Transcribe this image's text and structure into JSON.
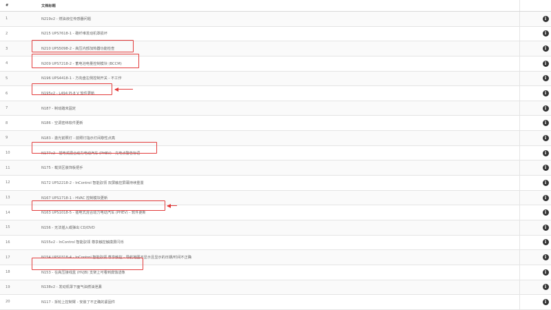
{
  "table": {
    "headers": {
      "num": "#",
      "title": "文档标题",
      "action": ""
    },
    "rows": [
      {
        "num": "1",
        "title": "N219v2 - 燃油液位传感器问题"
      },
      {
        "num": "2",
        "title": "N215 UPS7618-1 - 碳纤维发动机罩损坏"
      },
      {
        "num": "3",
        "title": "N210 UPS5098-2 - 高压内部加热器功能检查"
      },
      {
        "num": "4",
        "title": "N209 UPS7218-2 - 蓄电池电量控制模块 (BCCM)"
      },
      {
        "num": "5",
        "title": "N196 UPS4418-1 - 方向盘左侧控制开关 - 不工作"
      },
      {
        "num": "6",
        "title": "N195v2 - L494 PI-8 V 软件更新"
      },
      {
        "num": "7",
        "title": "N187 - 制动踏未固定"
      },
      {
        "num": "8",
        "title": "N186 - 空调密纬软件更新"
      },
      {
        "num": "9",
        "title": "N183 - 激光前照灯 - 前照灯指示灯间歇性点亮"
      },
      {
        "num": "10",
        "title": "N177v2 - 插电式混合动力电动汽车 (PHEV) - 充电点警告标语"
      },
      {
        "num": "11",
        "title": "N175 - 载货区装饰板把手"
      },
      {
        "num": "12",
        "title": "N172 UPS2218-2 - InControl 智能驭领 双屏触控屏幕持续重置"
      },
      {
        "num": "13",
        "title": "N167 UPS1718-1 - HVAC 控制模块更新"
      },
      {
        "num": "14",
        "title": "N163 UPS1018-5 - 插电式混合动力电动汽车 (PHEV) - 软件更新"
      },
      {
        "num": "15",
        "title": "N156 - 无法插入或弹出 CD/DVD"
      },
      {
        "num": "16",
        "title": "N155v2 - InControl 智能驭领 尊享触控触摸屏闪烁"
      },
      {
        "num": "17",
        "title": "N154 UPS0318-4 - InControl 智能驭领 尊享触控 - 导航地图不显示且显示的日期/时间不正确"
      },
      {
        "num": "18",
        "title": "N153 - 在高压接线盒 (HVJB) 支架上可看到腐蚀迹象"
      },
      {
        "num": "19",
        "title": "N138v2 - 发动机罩下面气油燃油泄漏"
      },
      {
        "num": "20",
        "title": "N117 - 拆轮上控制臂 - 安装了不正确的紧固件"
      }
    ],
    "info_icon_glyph": "i"
  }
}
